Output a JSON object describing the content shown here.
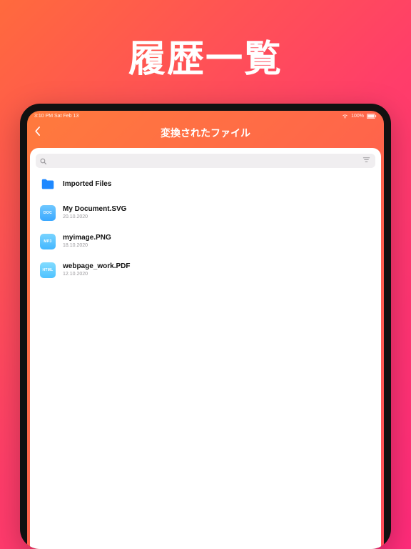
{
  "hero": {
    "title": "履歴一覧"
  },
  "status_bar": {
    "left": "3:10 PM  Sat Feb 13",
    "battery": "100%"
  },
  "nav": {
    "title": "変換されたファイル"
  },
  "search": {
    "placeholder": ""
  },
  "files": {
    "folder": {
      "title": "Imported Files"
    },
    "items": [
      {
        "badge": "DOC",
        "title": "My Document.SVG",
        "date": "20.10.2020"
      },
      {
        "badge": "MP3",
        "title": "myimage.PNG",
        "date": "18.10.2020"
      },
      {
        "badge": "HTML",
        "title": "webpage_work.PDF",
        "date": "12.10.2020"
      }
    ]
  }
}
